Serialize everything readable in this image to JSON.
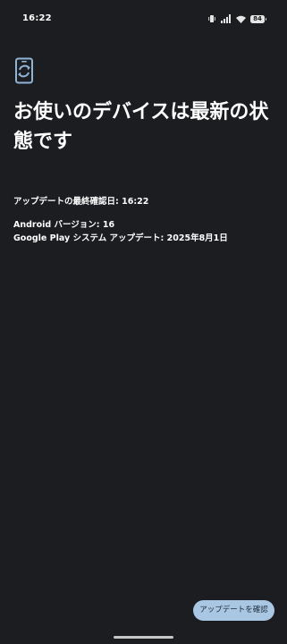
{
  "status_bar": {
    "time": "16:22",
    "battery": "84",
    "icons": [
      "vibrate-icon",
      "signal-icon",
      "wifi-icon",
      "battery-icon"
    ]
  },
  "main": {
    "icon": "system-update-icon",
    "title": "お使いのデバイスは最新の状態です",
    "last_check": "アップデートの最終確認日: 16:22",
    "android_version": "Android バージョン: 16",
    "gplay_update": "Google Play システム アップデート: 2025年8月1日"
  },
  "footer": {
    "check_button_label": "アップデートを確認"
  },
  "colors": {
    "background": "#1b1d21",
    "accent": "#a9c6e2",
    "icon": "#8fb4d6"
  }
}
